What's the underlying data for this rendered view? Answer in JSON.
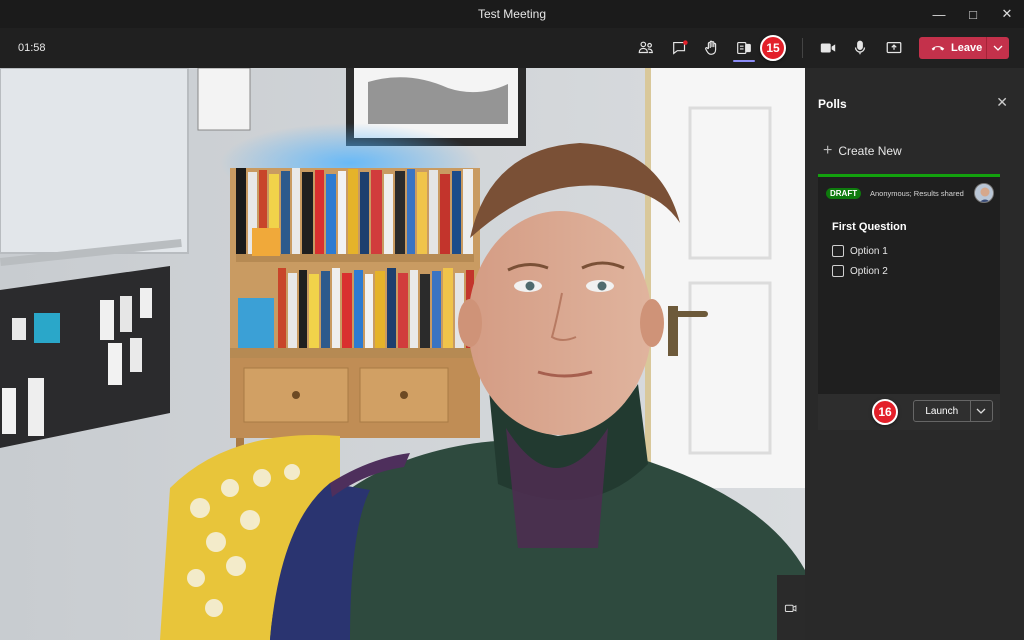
{
  "window": {
    "title": "Test Meeting",
    "controls": [
      "minimize-icon",
      "maximize-icon",
      "close-icon"
    ]
  },
  "toolbar": {
    "timer": "01:58",
    "icons": [
      "people-icon",
      "chat-icon",
      "raise-hand-icon",
      "apps-icon",
      "camera-icon",
      "microphone-icon",
      "share-icon"
    ],
    "leave_label": "Leave",
    "leave_color": "#c4314b",
    "active_color": "#8b8cf5"
  },
  "annotations": {
    "badge_toolbar": "15",
    "badge_launch": "16"
  },
  "panel": {
    "title": "Polls",
    "create_new": "Create New",
    "poll": {
      "status": "DRAFT",
      "settings": "Anonymous; Results shared",
      "question": "First Question",
      "options": [
        "Option 1",
        "Option 2"
      ],
      "accent_color": "#13a10e"
    },
    "launch_label": "Launch"
  }
}
